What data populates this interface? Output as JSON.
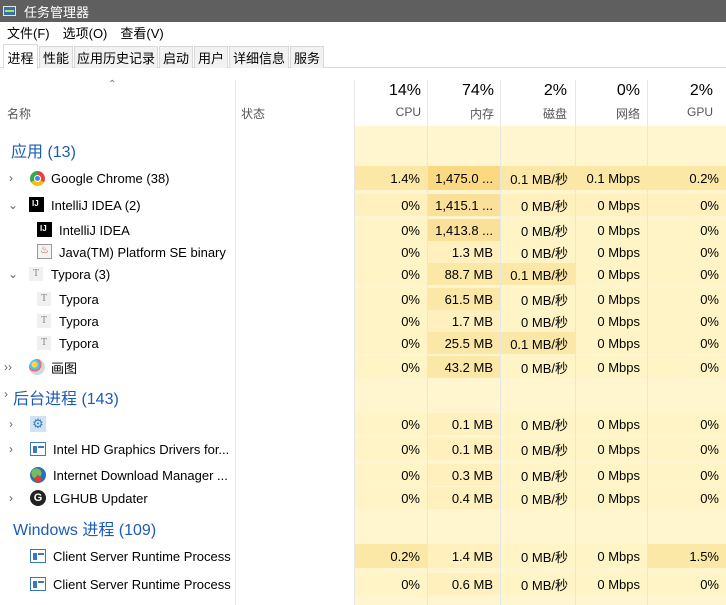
{
  "window": {
    "title": "任务管理器"
  },
  "menu": [
    "文件(F)",
    "选项(O)",
    "查看(V)"
  ],
  "tabs": [
    "进程",
    "性能",
    "应用历史记录",
    "启动",
    "用户",
    "详细信息",
    "服务"
  ],
  "header": {
    "name": "名称",
    "status": "状态",
    "columns": [
      {
        "percent": "14%",
        "label": "CPU"
      },
      {
        "percent": "74%",
        "label": "内存"
      },
      {
        "percent": "2%",
        "label": "磁盘"
      },
      {
        "percent": "0%",
        "label": "网络"
      },
      {
        "percent": "2%",
        "label": "GPU"
      }
    ]
  },
  "groups": {
    "apps": "应用 (13)",
    "background": "后台进程 (143)",
    "windows": "Windows 进程 (109)"
  },
  "rows": [
    {
      "name": "Google Chrome (38)",
      "cpu": "1.4%",
      "mem": "1,475.0 ...",
      "disk": "0.1 MB/秒",
      "net": "0.1 Mbps",
      "gpu": "0.2%"
    },
    {
      "name": "IntelliJ IDEA (2)",
      "cpu": "0%",
      "mem": "1,415.1 ...",
      "disk": "0 MB/秒",
      "net": "0 Mbps",
      "gpu": "0%"
    },
    {
      "name": "IntelliJ IDEA",
      "cpu": "0%",
      "mem": "1,413.8 ...",
      "disk": "0 MB/秒",
      "net": "0 Mbps",
      "gpu": "0%"
    },
    {
      "name": "Java(TM) Platform SE binary",
      "cpu": "0%",
      "mem": "1.3 MB",
      "disk": "0 MB/秒",
      "net": "0 Mbps",
      "gpu": "0%"
    },
    {
      "name": "Typora (3)",
      "cpu": "0%",
      "mem": "88.7 MB",
      "disk": "0.1 MB/秒",
      "net": "0 Mbps",
      "gpu": "0%"
    },
    {
      "name": "Typora",
      "cpu": "0%",
      "mem": "61.5 MB",
      "disk": "0 MB/秒",
      "net": "0 Mbps",
      "gpu": "0%"
    },
    {
      "name": "Typora",
      "cpu": "0%",
      "mem": "1.7 MB",
      "disk": "0 MB/秒",
      "net": "0 Mbps",
      "gpu": "0%"
    },
    {
      "name": "Typora",
      "cpu": "0%",
      "mem": "25.5 MB",
      "disk": "0.1 MB/秒",
      "net": "0 Mbps",
      "gpu": "0%"
    },
    {
      "name": "画图",
      "cpu": "0%",
      "mem": "43.2 MB",
      "disk": "0 MB/秒",
      "net": "0 Mbps",
      "gpu": "0%"
    },
    {
      "name": "",
      "cpu": "0%",
      "mem": "0.1 MB",
      "disk": "0 MB/秒",
      "net": "0 Mbps",
      "gpu": "0%"
    },
    {
      "name": "Intel HD Graphics Drivers for...",
      "cpu": "0%",
      "mem": "0.1 MB",
      "disk": "0 MB/秒",
      "net": "0 Mbps",
      "gpu": "0%"
    },
    {
      "name": "Internet Download Manager ...",
      "cpu": "0%",
      "mem": "0.3 MB",
      "disk": "0 MB/秒",
      "net": "0 Mbps",
      "gpu": "0%"
    },
    {
      "name": "LGHUB Updater",
      "cpu": "0%",
      "mem": "0.4 MB",
      "disk": "0 MB/秒",
      "net": "0 Mbps",
      "gpu": "0%"
    },
    {
      "name": "Client Server Runtime Process",
      "cpu": "0.2%",
      "mem": "1.4 MB",
      "disk": "0 MB/秒",
      "net": "0 Mbps",
      "gpu": "1.5%"
    },
    {
      "name": "Client Server Runtime Process",
      "cpu": "0%",
      "mem": "0.6 MB",
      "disk": "0 MB/秒",
      "net": "0 Mbps",
      "gpu": "0%"
    }
  ],
  "colors": {
    "heat_light": "#fff4c4",
    "heat_mid": "#f9eca8",
    "heat_strong": "#fbdf86",
    "group_blue": "#1c5bb8",
    "titlebar": "#5f5f5f"
  }
}
